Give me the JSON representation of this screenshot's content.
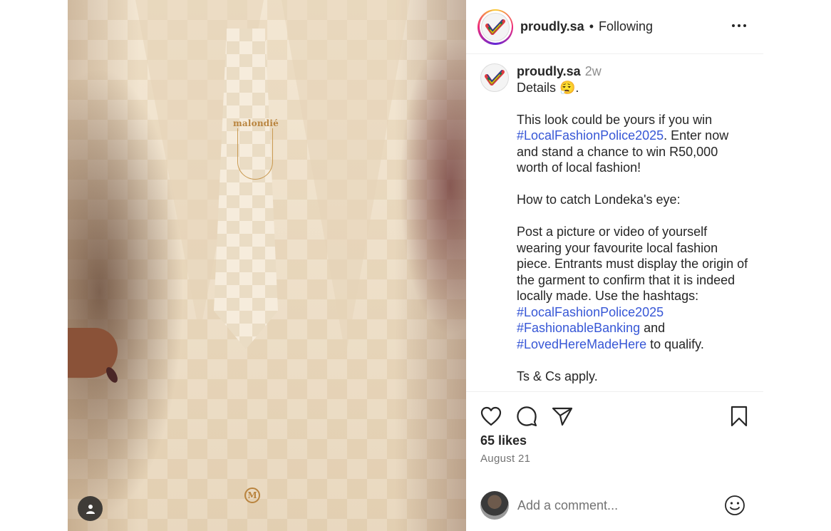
{
  "post": {
    "photo": {
      "brooch_text": "malondié",
      "button_mark": "M",
      "user_tag_icon": "person-icon"
    },
    "header": {
      "username": "proudly.sa",
      "separator": "•",
      "follow_status": "Following",
      "more_icon": "more-horizontal-icon"
    },
    "caption": {
      "username": "proudly.sa",
      "time": "2w",
      "line1": "Details 😮‍💨.",
      "para1": {
        "text_a": "This look could be yours if you win ",
        "hashtag": "#LocalFashionPolice2025",
        "text_b": ". Enter now and stand a chance to win R50,000 worth of local fashion!"
      },
      "para2": "How to catch Londeka's eye:",
      "para3": {
        "text": "Post a picture or video of yourself wearing your favourite local fashion piece. Entrants must display the origin of the garment to confirm that it is indeed locally made. Use the hashtags:",
        "hashtag1": "#LocalFashionPolice2025",
        "hashtag2": "#FashionableBanking",
        "and": " and",
        "hashtag3": "#LovedHereMadeHere",
        "tail": " to qualify."
      },
      "para4": "Ts & Cs apply."
    },
    "actions": {
      "like_icon": "heart-icon",
      "comment_icon": "comment-icon",
      "share_icon": "send-icon",
      "save_icon": "bookmark-icon"
    },
    "likes": "65 likes",
    "date": "August 21",
    "comment": {
      "placeholder": "Add a comment...",
      "emoji_icon": "smiley-icon"
    }
  },
  "colors": {
    "text": "#262626",
    "muted": "#737373",
    "hashtag": "#3757d6",
    "divider": "#efefef"
  }
}
